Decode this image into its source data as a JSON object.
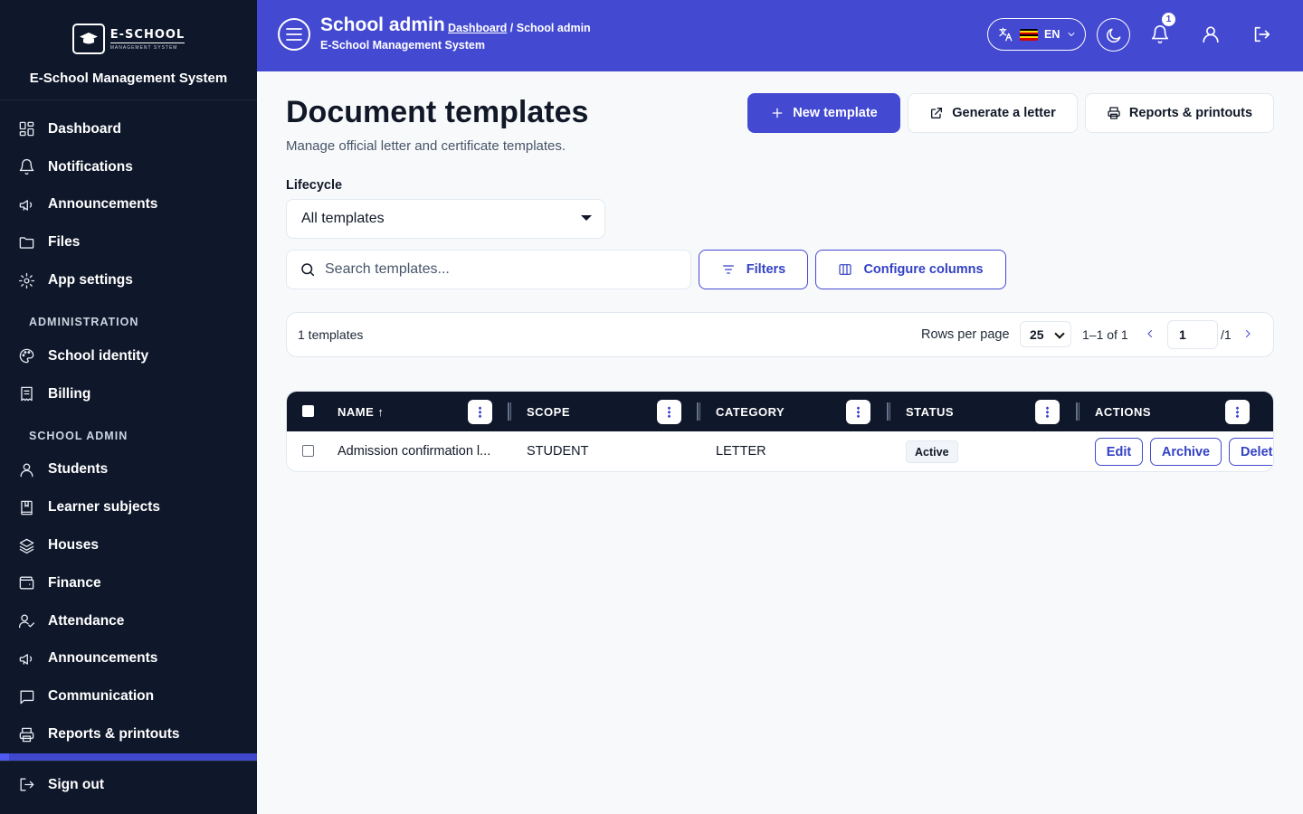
{
  "sidebar": {
    "logo_text": "E-SCHOOL",
    "logo_subtext": "MANAGEMENT SYSTEM",
    "brand_name": "E-School Management System",
    "main_items": [
      {
        "label": "Dashboard",
        "icon": "dashboard-icon"
      },
      {
        "label": "Notifications",
        "icon": "bell-icon"
      },
      {
        "label": "Announcements",
        "icon": "megaphone-icon"
      },
      {
        "label": "Files",
        "icon": "folder-icon"
      },
      {
        "label": "App settings",
        "icon": "gear-icon"
      }
    ],
    "section_admin": "ADMINISTRATION",
    "admin_items": [
      {
        "label": "School identity",
        "icon": "palette-icon"
      },
      {
        "label": "Billing",
        "icon": "receipt-icon"
      }
    ],
    "section_school": "SCHOOL ADMIN",
    "school_items": [
      {
        "label": "Students",
        "icon": "user-icon"
      },
      {
        "label": "Learner subjects",
        "icon": "book-icon"
      },
      {
        "label": "Houses",
        "icon": "layers-icon"
      },
      {
        "label": "Finance",
        "icon": "wallet-icon"
      },
      {
        "label": "Attendance",
        "icon": "user-check-icon"
      },
      {
        "label": "Announcements",
        "icon": "megaphone-icon"
      },
      {
        "label": "Communication",
        "icon": "message-icon"
      },
      {
        "label": "Reports & printouts",
        "icon": "printer-icon"
      }
    ],
    "sign_out": "Sign out"
  },
  "topbar": {
    "title": "School admin",
    "breadcrumb_link": "Dashboard",
    "breadcrumb_current": "/ School admin",
    "subtitle": "E-School Management System",
    "language": "EN",
    "notification_count": "1",
    "accent_color": "#4349d1"
  },
  "page": {
    "title": "Document templates",
    "description": "Manage official letter and certificate templates.",
    "new_template": "New template",
    "generate_letter": "Generate a letter",
    "reports": "Reports & printouts"
  },
  "filters": {
    "lifecycle_label": "Lifecycle",
    "lifecycle_value": "All templates",
    "search_placeholder": "Search templates...",
    "filters_button": "Filters",
    "configure_columns": "Configure columns"
  },
  "pagination": {
    "count": "1 templates",
    "rows_per_page_label": "Rows per page",
    "rows_per_page": "25",
    "range": "1–1 of 1",
    "page": "1",
    "total_pages": "/1"
  },
  "table": {
    "columns": [
      "NAME ↑",
      "SCOPE",
      "CATEGORY",
      "STATUS",
      "ACTIONS"
    ],
    "rows": [
      {
        "name": "Admission confirmation l...",
        "scope": "STUDENT",
        "category": "LETTER",
        "status": "Active",
        "actions": [
          "Edit",
          "Archive",
          "Delet"
        ]
      }
    ]
  }
}
